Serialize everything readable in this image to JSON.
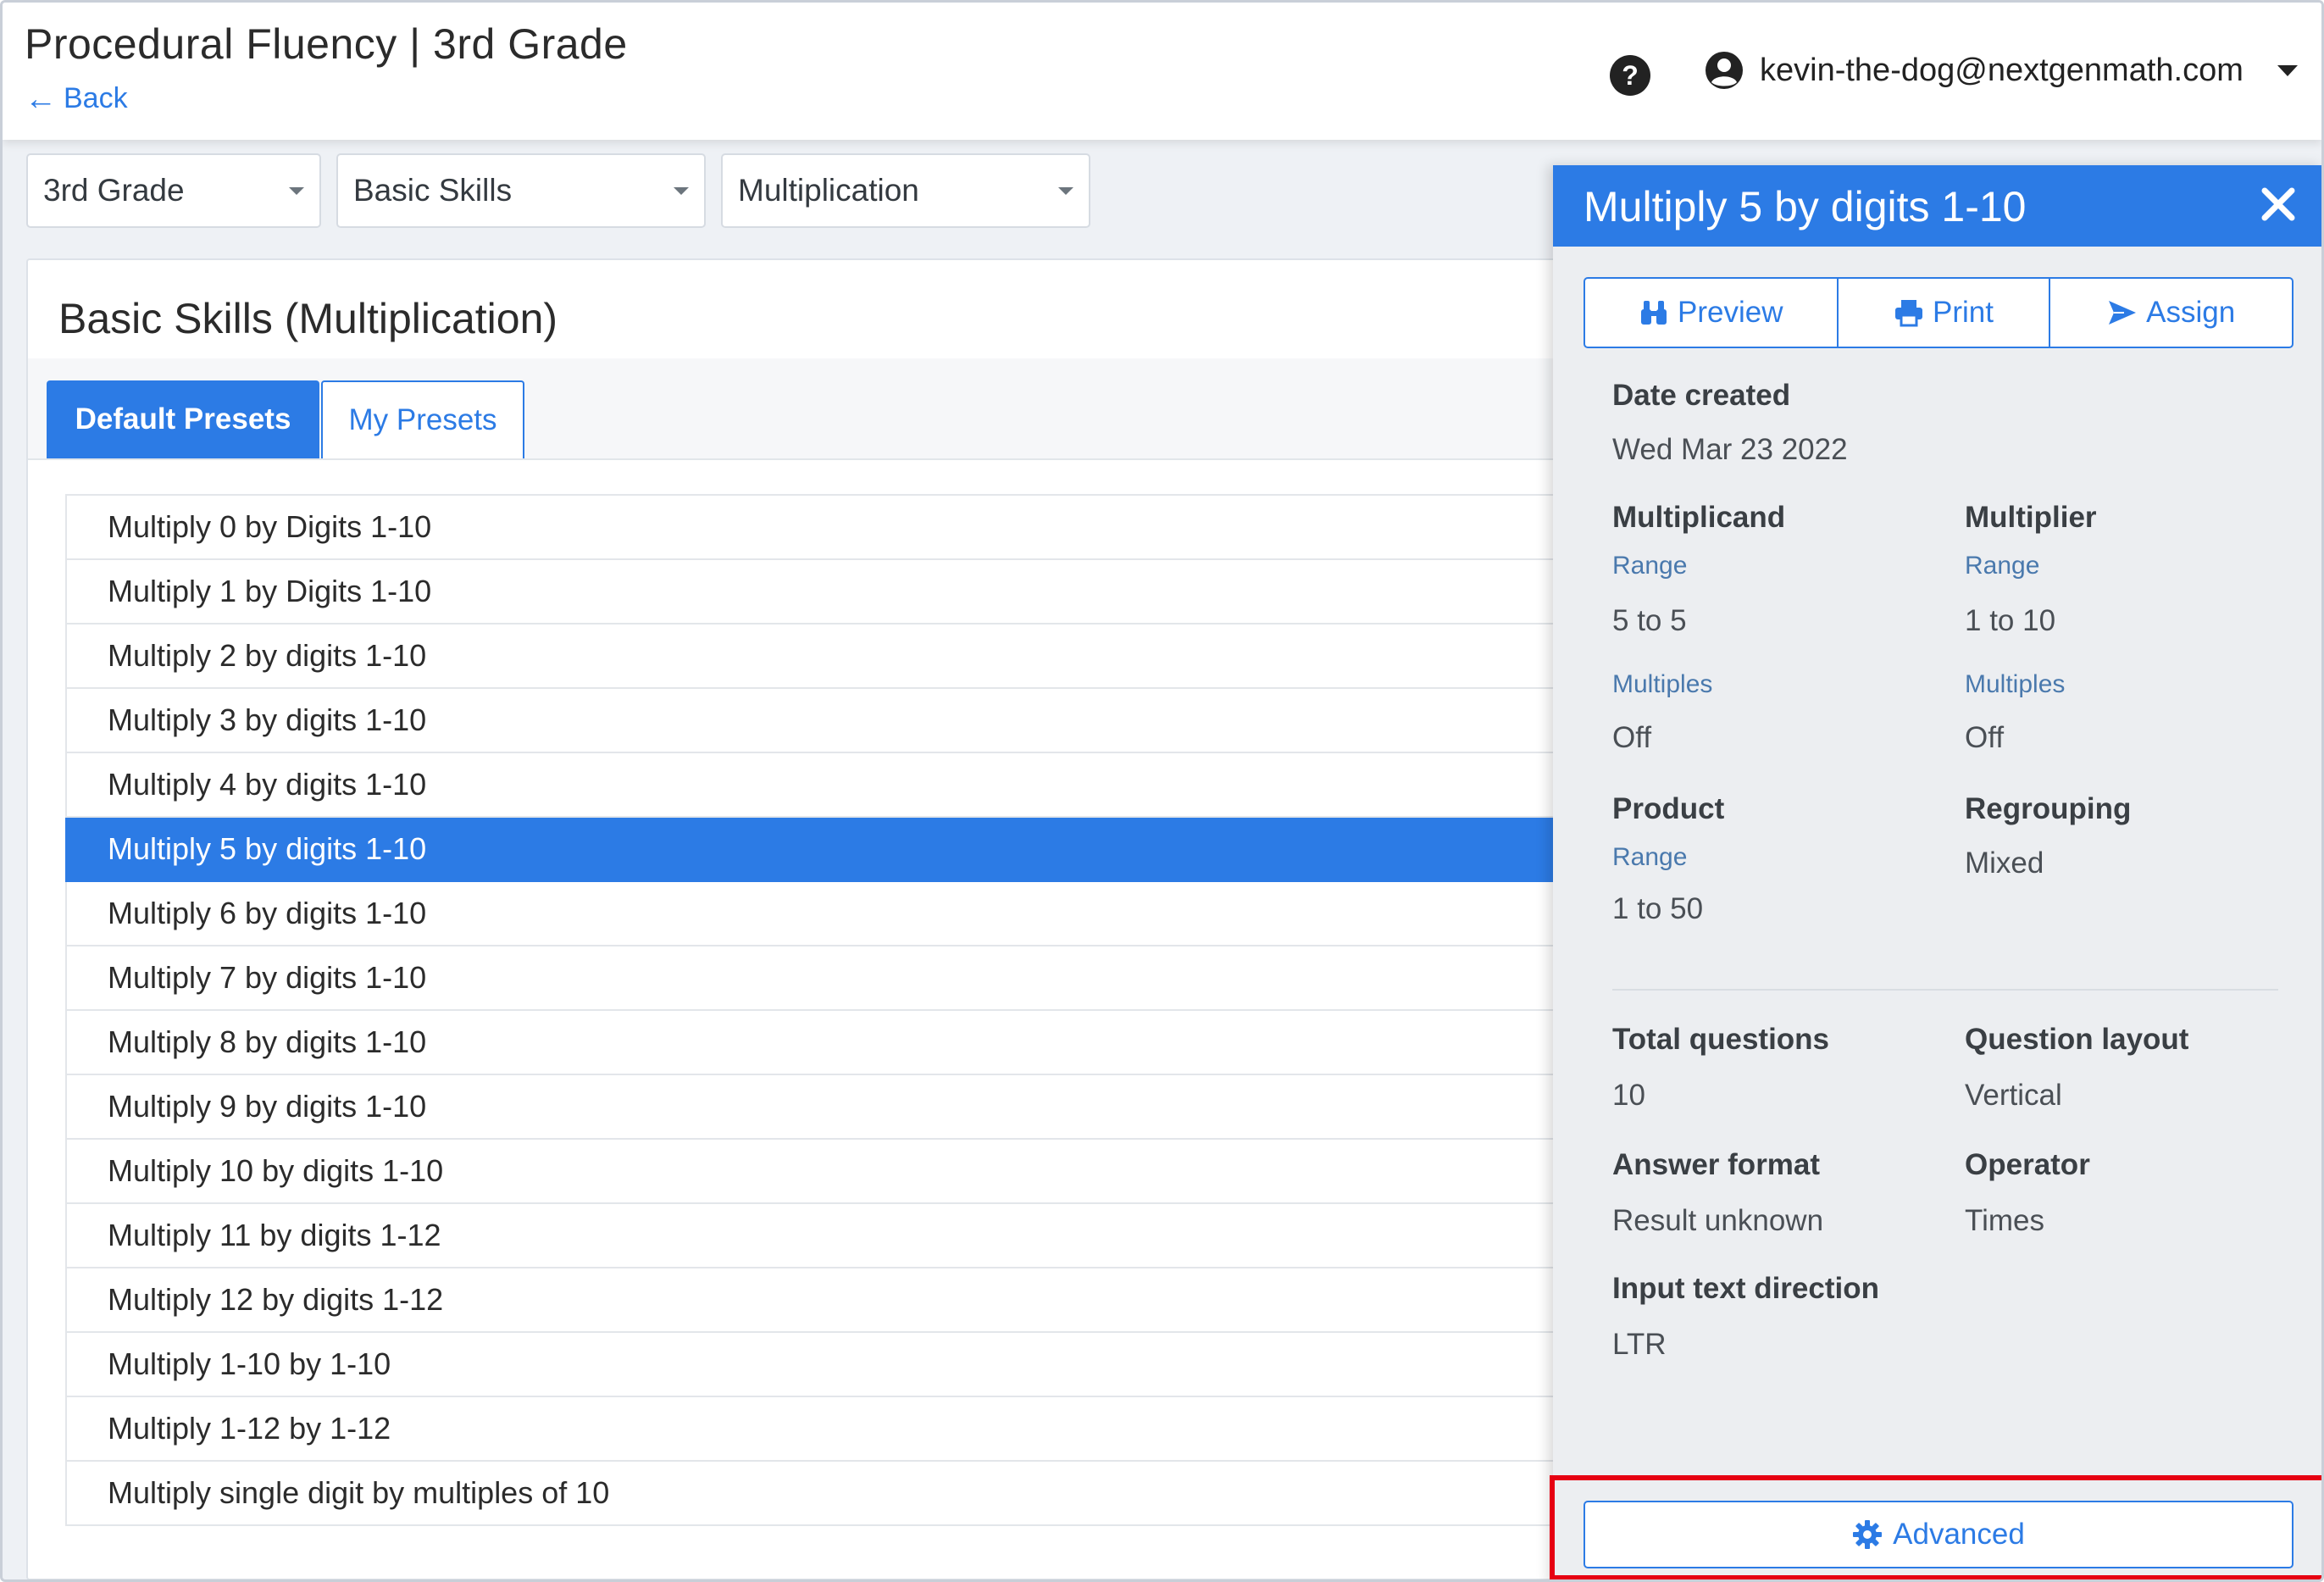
{
  "header": {
    "title": "Procedural Fluency | 3rd Grade",
    "back_label": "Back",
    "user_email": "kevin-the-dog@nextgenmath.com",
    "help_icon": "question-circle-icon",
    "avatar_icon": "user-circle-icon"
  },
  "filters": {
    "grade": "3rd Grade",
    "category": "Basic Skills",
    "operation": "Multiplication"
  },
  "main": {
    "title": "Basic Skills (Multiplication)",
    "tabs": [
      {
        "label": "Default Presets",
        "active": true
      },
      {
        "label": "My Presets",
        "active": false
      }
    ],
    "presets": [
      "Multiply 0 by Digits 1-10",
      "Multiply 1 by Digits 1-10",
      "Multiply 2 by digits 1-10",
      "Multiply 3 by digits 1-10",
      "Multiply 4 by digits 1-10",
      "Multiply 5 by digits 1-10",
      "Multiply 6 by digits 1-10",
      "Multiply 7 by digits 1-10",
      "Multiply 8 by digits 1-10",
      "Multiply 9 by digits 1-10",
      "Multiply 10 by digits 1-10",
      "Multiply 11 by digits 1-12",
      "Multiply 12 by digits 1-12",
      "Multiply 1-10 by 1-10",
      "Multiply 1-12 by 1-12",
      "Multiply single digit by multiples of 10"
    ],
    "selected_index": 5
  },
  "panel": {
    "title": "Multiply 5 by digits 1-10",
    "buttons": {
      "preview": "Preview",
      "print": "Print",
      "assign": "Assign"
    },
    "date_created_label": "Date created",
    "date_created": "Wed Mar 23 2022",
    "multiplicand": {
      "label": "Multiplicand",
      "range_label": "Range",
      "range": "5 to 5",
      "multiples_label": "Multiples",
      "multiples": "Off"
    },
    "multiplier": {
      "label": "Multiplier",
      "range_label": "Range",
      "range": "1 to 10",
      "multiples_label": "Multiples",
      "multiples": "Off"
    },
    "product": {
      "label": "Product",
      "range_label": "Range",
      "range": "1 to 50"
    },
    "regrouping": {
      "label": "Regrouping",
      "value": "Mixed"
    },
    "total_questions": {
      "label": "Total questions",
      "value": "10"
    },
    "question_layout": {
      "label": "Question layout",
      "value": "Vertical"
    },
    "answer_format": {
      "label": "Answer format",
      "value": "Result unknown"
    },
    "operator": {
      "label": "Operator",
      "value": "Times"
    },
    "input_direction": {
      "label": "Input text direction",
      "value": "LTR"
    },
    "advanced_label": "Advanced"
  },
  "colors": {
    "accent": "#2c7be5",
    "highlight": "#e60012",
    "panel_bg": "#eceef1"
  }
}
